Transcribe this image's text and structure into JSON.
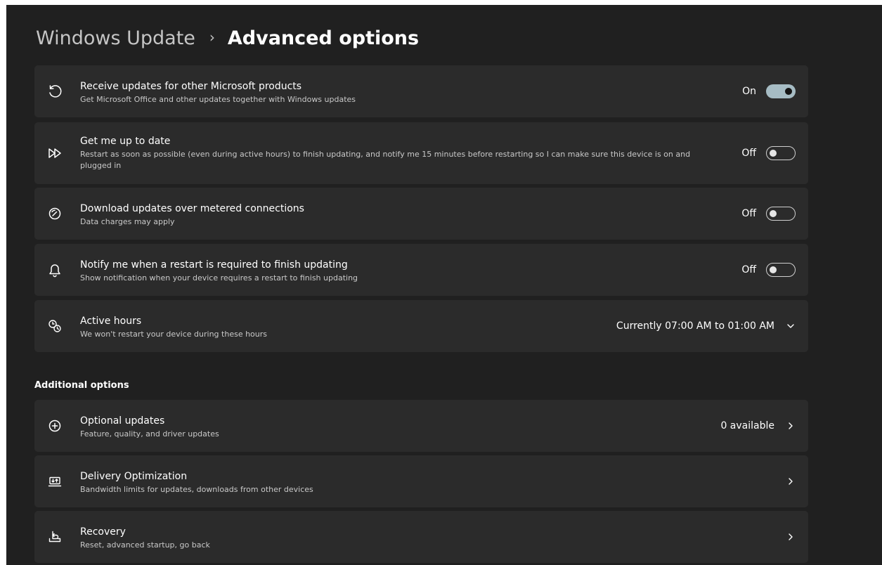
{
  "breadcrumb": {
    "parent": "Windows Update",
    "separator": "›",
    "current": "Advanced options"
  },
  "settings": [
    {
      "icon": "refresh-icon",
      "title": "Receive updates for other Microsoft products",
      "description": "Get Microsoft Office and other updates together with Windows updates",
      "toggle_state": "On",
      "toggle_on": true
    },
    {
      "icon": "fast-forward-icon",
      "title": "Get me up to date",
      "description": "Restart as soon as possible (even during active hours) to finish updating, and notify me 15 minutes before restarting so I can make sure this device is on and plugged in",
      "toggle_state": "Off",
      "toggle_on": false
    },
    {
      "icon": "speedometer-icon",
      "title": "Download updates over metered connections",
      "description": "Data charges may apply",
      "toggle_state": "Off",
      "toggle_on": false
    },
    {
      "icon": "bell-icon",
      "title": "Notify me when a restart is required to finish updating",
      "description": "Show notification when your device requires a restart to finish updating",
      "toggle_state": "Off",
      "toggle_on": false
    },
    {
      "icon": "active-hours-clock-icon",
      "title": "Active hours",
      "description": "We won't restart your device during these hours",
      "value": "Currently 07:00 AM to 01:00 AM",
      "control": "chevron-down-icon"
    }
  ],
  "additional_options": {
    "heading": "Additional options",
    "items": [
      {
        "icon": "circle-plus-icon",
        "title": "Optional updates",
        "description": "Feature, quality, and driver updates",
        "value": "0 available",
        "control": "chevron-right-icon"
      },
      {
        "icon": "delivery-optimization-icon",
        "title": "Delivery Optimization",
        "description": "Bandwidth limits for updates, downloads from other devices",
        "control": "chevron-right-icon"
      },
      {
        "icon": "recovery-icon",
        "title": "Recovery",
        "description": "Reset, advanced startup, go back",
        "control": "chevron-right-icon"
      }
    ]
  },
  "colors": {
    "background": "#202020",
    "card": "#2b2b2b",
    "toggle_on": "#a6bcc4",
    "text_primary": "#ffffff",
    "text_secondary": "#c9c9c9"
  }
}
